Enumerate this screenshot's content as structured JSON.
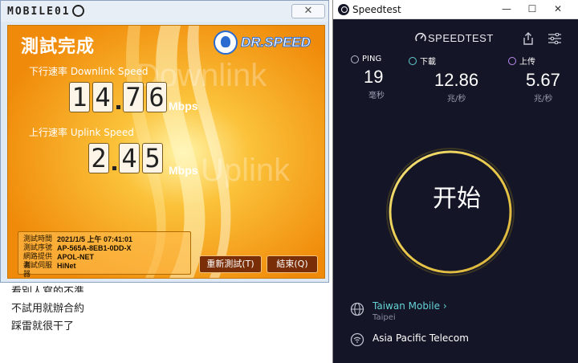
{
  "watermark": "MOBILE01",
  "drspeed": {
    "close_label": "✕",
    "title": "測試完成",
    "logo": "DR.SPEED",
    "bg_downlink": "Downlink",
    "bg_uplink": "Uplink",
    "downlink_label": "下行速率 Downlink Speed",
    "downlink_digits": [
      "1",
      "4",
      "7",
      "6"
    ],
    "uplink_label": "上行速率 Uplink Speed",
    "uplink_digits": [
      "2",
      "4",
      "5"
    ],
    "unit": "Mbps",
    "info": [
      {
        "key": "測試時間",
        "value": "2021/1/5 上午 07:41:01"
      },
      {
        "key": "測試序號",
        "value": "AP-565A-8EB1-0DD-X"
      },
      {
        "key": "網路提供者",
        "value": "APOL-NET"
      },
      {
        "key": "測試伺服器",
        "value": "HiNet"
      }
    ],
    "retest_button": "重新測試(T)",
    "end_button": "結束(Q)"
  },
  "page_text": [
    "看別人寫的不準",
    "不試用就辦合約",
    "踩雷就很干了"
  ],
  "speedtest": {
    "window_title": "Speedtest",
    "minimize": "—",
    "maximize": "☐",
    "close": "✕",
    "logo": "SPEEDTEST",
    "ping": {
      "label": "PING",
      "value": "19",
      "unit": "毫秒"
    },
    "download": {
      "label": "下載",
      "value": "12.86",
      "unit": "兆/秒"
    },
    "upload": {
      "label": "上传",
      "value": "5.67",
      "unit": "兆/秒"
    },
    "go_label": "开始",
    "isp_name": "Taiwan Mobile",
    "isp_arrow": "›",
    "isp_location": "Taipei",
    "server_name": "Asia Pacific Telecom"
  },
  "colors": {
    "drspeed_orange": "#f59a13",
    "speedtest_bg": "#141526",
    "ping_icon": "#b9bbcc",
    "download_icon": "#64d2d4",
    "upload_icon": "#b98af0",
    "isp_link": "#64d2d4"
  }
}
